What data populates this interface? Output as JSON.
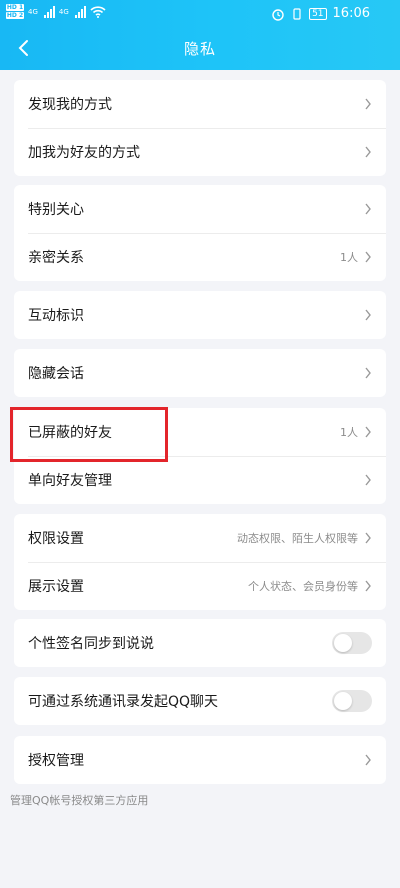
{
  "status_bar": {
    "sim1": "HD 1",
    "sim2": "HD 2",
    "network1": "4G",
    "network2": "4G",
    "battery": "51",
    "time": "16:06"
  },
  "header": {
    "title": "隐私"
  },
  "groups": {
    "g1": {
      "find_me": "发现我的方式",
      "add_friend": "加我为好友的方式"
    },
    "g2": {
      "special_care": "特别关心",
      "intimate": "亲密关系",
      "intimate_value": "1人"
    },
    "g3": {
      "interaction": "互动标识"
    },
    "g4": {
      "hidden_chat": "隐藏会话"
    },
    "g5": {
      "blocked": "已屏蔽的好友",
      "blocked_value": "1人",
      "one_way": "单向好友管理"
    },
    "g6": {
      "permission": "权限设置",
      "permission_value": "动态权限、陌生人权限等",
      "display": "展示设置",
      "display_value": "个人状态、会员身份等"
    },
    "g7": {
      "signature_sync": "个性签名同步到说说",
      "signature_sync_on": false
    },
    "g8": {
      "contacts_chat": "可通过系统通讯录发起QQ聊天",
      "contacts_chat_on": false
    },
    "g9": {
      "auth": "授权管理"
    }
  },
  "footnote": "管理QQ帐号授权第三方应用",
  "colors": {
    "header": "#1ec4f8",
    "highlight": "#e3252b",
    "background": "#f3f4f8"
  }
}
